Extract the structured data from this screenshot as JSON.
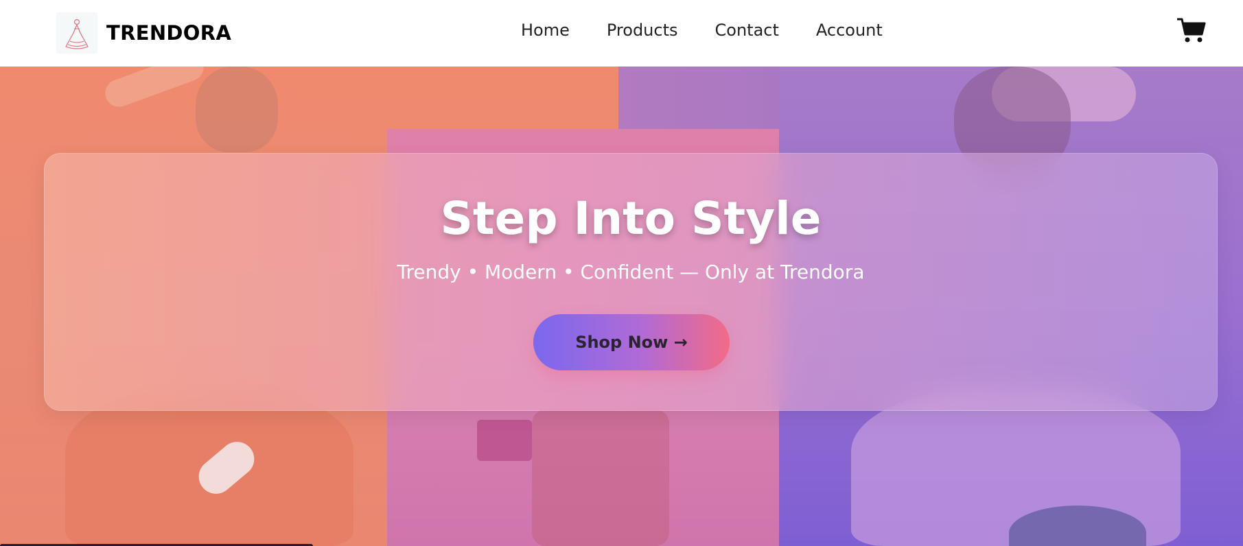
{
  "header": {
    "brand": "TRENDORA",
    "logo_icon": "dress-logo-icon",
    "nav": [
      {
        "label": "Home"
      },
      {
        "label": "Products"
      },
      {
        "label": "Contact"
      },
      {
        "label": "Account"
      }
    ],
    "cart_icon": "shopping-cart-icon"
  },
  "hero": {
    "title": "Step Into Style",
    "subtitle": "Trendy • Modern • Confident — Only at Trendora",
    "cta_label": "Shop Now →"
  },
  "colors": {
    "accent_start": "#7b68ee",
    "accent_end": "#f26b87",
    "panel_left": "#f08a6e",
    "panel_mid": "#df80a8",
    "panel_right": "#9a6fd0"
  }
}
